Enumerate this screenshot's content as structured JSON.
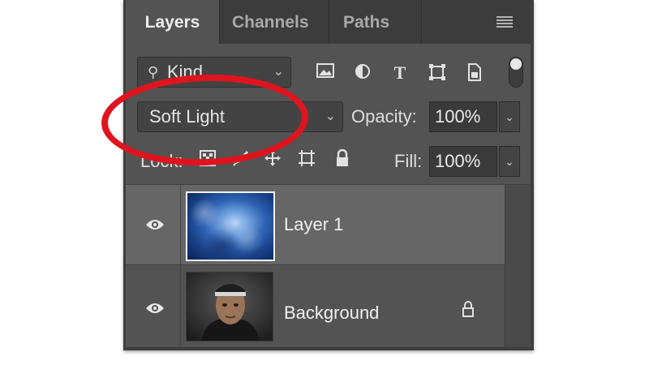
{
  "tabs": [
    {
      "label": "Layers",
      "active": true
    },
    {
      "label": "Channels",
      "active": false
    },
    {
      "label": "Paths",
      "active": false
    }
  ],
  "filter": {
    "kind_label": "Kind",
    "icons": [
      "image-filter-icon",
      "adjustment-filter-icon",
      "type-filter-icon",
      "shape-filter-icon",
      "smart-object-filter-icon"
    ]
  },
  "blend_mode": "Soft Light",
  "opacity": {
    "label": "Opacity:",
    "value": "100%"
  },
  "lock": {
    "label": "Lock:",
    "icons": [
      "lock-transparent-pixels-icon",
      "lock-image-pixels-icon",
      "lock-position-icon",
      "lock-artboard-icon",
      "lock-all-icon"
    ]
  },
  "fill": {
    "label": "Fill:",
    "value": "100%"
  },
  "layers": [
    {
      "name": "Layer 1",
      "selected": true,
      "visible": true,
      "locked": false
    },
    {
      "name": "Background",
      "selected": false,
      "visible": true,
      "locked": true
    }
  ],
  "colors": {
    "panel_bg": "#535353",
    "selected_layer": "#666666",
    "annotation": "#e0141e"
  }
}
